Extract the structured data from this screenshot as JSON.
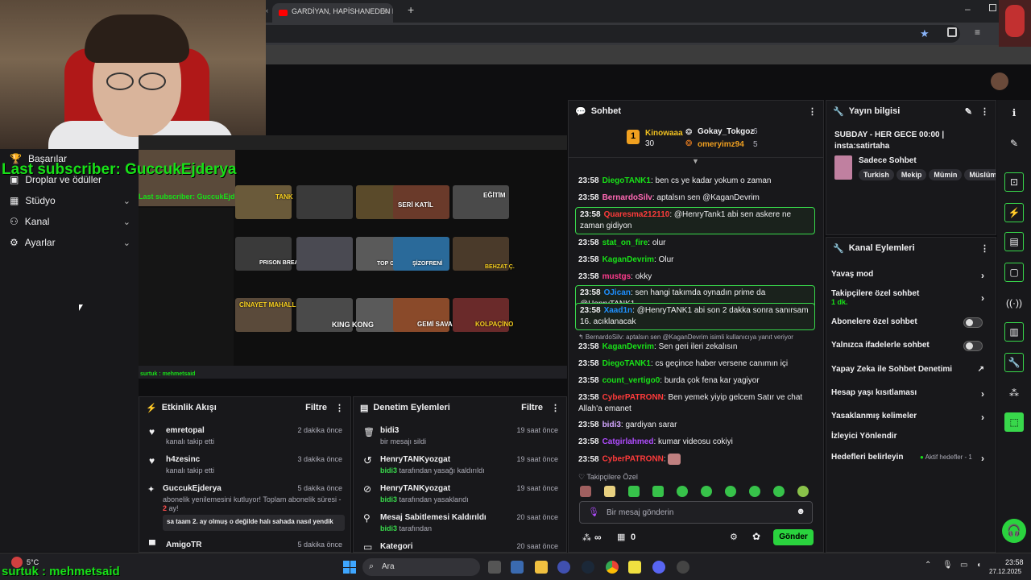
{
  "browser": {
    "tab_title": "GARDİYAN, HAPİSHANEDEN K..."
  },
  "overlay": {
    "last_subscriber": "Last subscriber: GuccukEjderya",
    "follower": "surtuk : mehmetsaid"
  },
  "leftnav": {
    "items": [
      {
        "label": "Başarılar"
      },
      {
        "label": "Droplar ve ödüller"
      },
      {
        "label": "Stüdyo"
      },
      {
        "label": "Kanal"
      },
      {
        "label": "Ayarlar"
      }
    ]
  },
  "preview": {
    "subscriber_text": "Last subscriber: GuccukEjderya",
    "follower_text": "surtuk : mehmetsaid",
    "thumb_labels": [
      "TANK",
      "SERİ KATİL",
      "EĞİTİM",
      "PRISON BREAK",
      "TOP GUN",
      "ŞİZOFRENİ",
      "BEHZAT Ç.",
      "CİNAYET MAHALLİ",
      "KING KONG",
      "GEMİ SAVAŞI",
      "KOLPAÇİNO"
    ]
  },
  "activity": {
    "title": "Etkinlik Akışı",
    "filter": "Filtre",
    "items": [
      {
        "name": "emretopal",
        "sub": "kanalı takip etti",
        "time": "2 dakika önce"
      },
      {
        "name": "h4zesinc",
        "sub": "kanalı takip etti",
        "time": "3 dakika önce"
      },
      {
        "name": "GuccukEjderya",
        "sub": "abonelik yenilemesini kutluyor! Toplam abonelik süresi - ",
        "months": "2",
        "sub2": "ay!",
        "message": "sa taam 2. ay olmuş o değilde halı sahada nasıl yendik",
        "time": "5 dakika önce"
      },
      {
        "name": "AmigoTR",
        "time": "5 dakika önce"
      }
    ]
  },
  "moderation": {
    "title": "Denetim Eylemleri",
    "filter": "Filtre",
    "items": [
      {
        "name": "bidi3",
        "sub": "bir mesajı sildi",
        "time": "19 saat önce"
      },
      {
        "name": "HenryTANKyozgat",
        "actor": "bidi3",
        "sub": " tarafından yasağı kaldırıldı",
        "time": "19 saat önce"
      },
      {
        "name": "HenryTANKyozgat",
        "actor": "bidi3",
        "sub": " tarafından yasaklandı",
        "time": "19 saat önce"
      },
      {
        "name": "Mesaj Sabitlemesi Kaldırıldı",
        "actor": "bidi3",
        "sub": " tarafından",
        "time": "20 saat önce"
      },
      {
        "name": "Kategori",
        "time": "20 saat önce"
      }
    ]
  },
  "chat": {
    "title": "Sohbet",
    "top_gifters": [
      {
        "name": "Kinowaaa",
        "count": "30"
      },
      {
        "name": "Gokay_Tokgoz",
        "count": "6"
      },
      {
        "name": "omeryimz94",
        "count": "5"
      }
    ],
    "messages": [
      {
        "ts": "23:58",
        "user": "DiegoTANK1",
        "color": "#18e018",
        "text": "ben cs ye kadar yokum o zaman"
      },
      {
        "ts": "23:58",
        "user": "BernardoSilv",
        "color": "#ff69b4",
        "text": "aptalsın sen @KaganDevrim"
      },
      {
        "ts": "23:58",
        "user": "Quaresma212110",
        "color": "#ff3b3b",
        "text": "@HenryTank1 abi sen askere ne zaman gidiyon",
        "highlight": true
      },
      {
        "ts": "23:58",
        "user": "stat_on_fire",
        "color": "#18e018",
        "text": "olur"
      },
      {
        "ts": "23:58",
        "user": "KaganDevrim",
        "color": "#18e018",
        "text": "Olur"
      },
      {
        "ts": "23:58",
        "user": "mustgs",
        "color": "#ff3b8d",
        "text": "okky"
      },
      {
        "ts": "23:58",
        "user": "OJican",
        "color": "#1e90ff",
        "text": "sen hangi takımda oynadın prime da @HenryTANK1",
        "highlight": true
      },
      {
        "ts": "23:58",
        "user": "Xaad1n",
        "color": "#1e90ff",
        "text": "@HenryTANK1 abi son 2 dakka sonra sanırsam 16. acıklanacak",
        "highlight": true
      },
      {
        "ts": "",
        "user": "",
        "color": "#adadb8",
        "text": "↰ BernardoSilv: aptalsın sen @KaganDevrim isimli kullanıcıya yanıt veriyor"
      },
      {
        "ts": "23:58",
        "user": "KaganDevrim",
        "color": "#18e018",
        "text": "Sen geri ileri zekalısın"
      },
      {
        "ts": "23:58",
        "user": "DiegoTANK1",
        "color": "#18e018",
        "text": "cs geçince haber versene canımın içi"
      },
      {
        "ts": "23:58",
        "user": "count_vertigo0",
        "color": "#18e018",
        "text": "burda çok fena kar yagiyor"
      },
      {
        "ts": "23:58",
        "user": "CyberPATRONN",
        "color": "#ff3b3b",
        "text": "Ben yemek yiyip gelcem Satır ve chat Allah'a emanet"
      },
      {
        "ts": "23:58",
        "user": "bidi3",
        "color": "#d2a6ff",
        "text": "gardiyan sarar"
      },
      {
        "ts": "23:58",
        "user": "Catgirlahmed",
        "color": "#b04cff",
        "text": "kumar videosu cokiyi"
      },
      {
        "ts": "23:58",
        "user": "CyberPATRONN",
        "color": "#ff3b3b",
        "text": ""
      }
    ],
    "emote_label": "Takipçilere Özel",
    "input_placeholder": "Bir mesaj gönderin",
    "points": "∞",
    "gifts": "0",
    "send_label": "Gönder"
  },
  "stream_info": {
    "title": "Yayın bilgisi",
    "stream_title": "SUBDAY - HER GECE 00:00 | insta:satirtaha",
    "category": "Sadece Sohbet",
    "tags": [
      "Turkish",
      "Mekip",
      "Mümin",
      "Müslüm"
    ]
  },
  "channel_actions": {
    "title": "Kanal Eylemleri",
    "items": [
      {
        "label": "Yavaş mod",
        "kind": "chevron"
      },
      {
        "label": "Takipçilere özel sohbet",
        "sub": "1 dk.",
        "kind": "chevron"
      },
      {
        "label": "Abonelere özel sohbet",
        "kind": "toggle"
      },
      {
        "label": "Yalnızca ifadelerle sohbet",
        "kind": "toggle"
      },
      {
        "label": "Yapay Zeka ile Sohbet Denetimi",
        "kind": "external"
      },
      {
        "label": "Hesap yaşı kısıtlaması",
        "kind": "chevron"
      },
      {
        "label": "Yasaklanmış kelimeler",
        "kind": "chevron"
      },
      {
        "label": "İzleyici Yönlendir",
        "kind": "none"
      },
      {
        "label": "Hedefleri belirleyin",
        "badge": "Aktif hedefler - 1",
        "kind": "chevron"
      }
    ]
  },
  "taskbar": {
    "weather": "5°C",
    "search": "Ara",
    "time": "23:58",
    "date": "27.12.2025"
  }
}
